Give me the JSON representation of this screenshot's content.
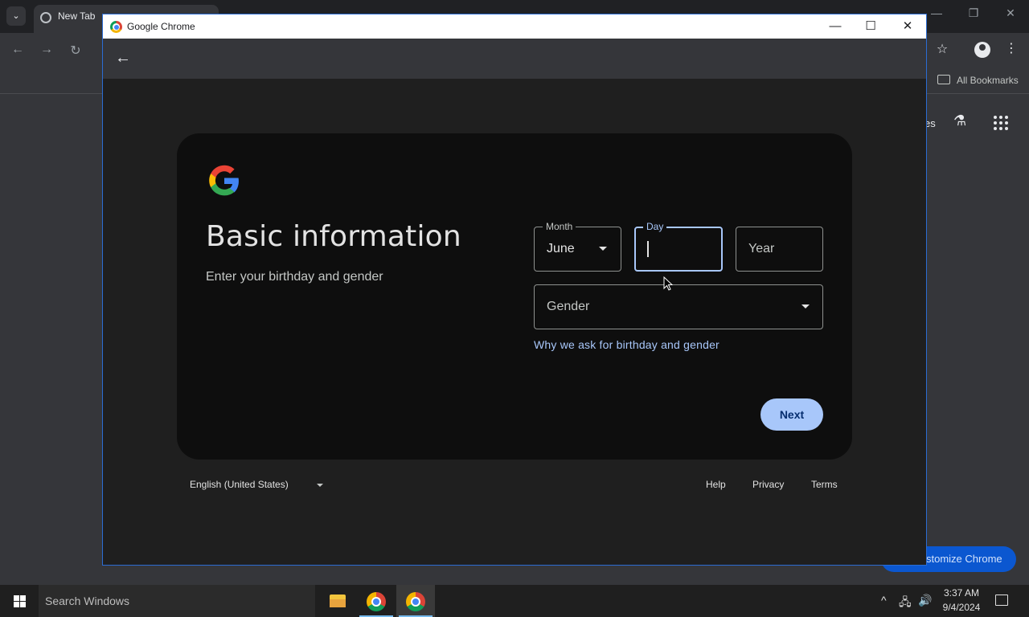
{
  "background_window": {
    "tab_title": "New Tab",
    "bookmarks_label": "All Bookmarks",
    "images_fragment": "es",
    "customize_label": "stomize Chrome",
    "nav": {
      "back": "←",
      "forward": "→",
      "reload": "↻"
    },
    "star": "☆",
    "menu": "⋮",
    "flask": "⚗",
    "controls": {
      "minimize": "—",
      "restore": "❐",
      "close": "✕"
    }
  },
  "popup": {
    "title": "Google Chrome",
    "controls": {
      "minimize": "—",
      "maximize": "☐",
      "close": "✕"
    },
    "back_arrow": "←",
    "page": {
      "title": "Basic information",
      "subtitle": "Enter your birthday and gender",
      "fields": {
        "month": {
          "label": "Month",
          "value": "June"
        },
        "day": {
          "label": "Day",
          "value": ""
        },
        "year": {
          "placeholder": "Year"
        },
        "gender": {
          "placeholder": "Gender"
        }
      },
      "why_link": "Why we ask for birthday and gender",
      "next_button": "Next",
      "footer": {
        "language": "English (United States)",
        "links": [
          "Help",
          "Privacy",
          "Terms"
        ]
      }
    }
  },
  "taskbar": {
    "search_placeholder": "Search Windows",
    "clock_time": "3:37 AM",
    "clock_date": "9/4/2024",
    "tray": {
      "chevron": "^",
      "network": "🖧",
      "volume": "🔊"
    }
  },
  "colors": {
    "accent": "#a8c7fa",
    "card_bg": "#0e0e0e",
    "page_bg": "#1f1f1f",
    "window_border": "#2b6cd3"
  }
}
